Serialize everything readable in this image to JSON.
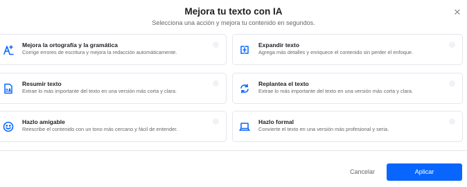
{
  "dialog": {
    "title": "Mejora tu texto con IA",
    "subtitle": "Selecciona una acción y mejora tu contenido en segundos.",
    "close_icon": "close-icon"
  },
  "options": [
    {
      "title": "Mejora la ortografía y la gramática",
      "description": "Corrige errores de escritura y mejora la redacción automáticamente.",
      "icon": "spellcheck-icon"
    },
    {
      "title": "Expandir texto",
      "description": "Agrega más detalles y enriquece el contenido sin perder el enfoque.",
      "icon": "expand-text-icon"
    },
    {
      "title": "Resumir texto",
      "description": "Extrae lo más importante del texto en una versión más corta y clara.",
      "icon": "summarize-icon"
    },
    {
      "title": "Replantea el texto",
      "description": "Extrae lo más importante del texto en una versión más corta y clara.",
      "icon": "rephrase-icon"
    },
    {
      "title": "Hazlo amigable",
      "description": "Reescribe el contenido con un tono más cercano y fácil de entender.",
      "icon": "smile-icon"
    },
    {
      "title": "Hazlo formal",
      "description": "Convierte el texto en una versión más profesional y seria.",
      "icon": "laptop-icon"
    }
  ],
  "footer": {
    "cancel_label": "Cancelar",
    "apply_label": "Aplicar"
  },
  "colors": {
    "accent": "#0866ff",
    "border": "#e4e6eb",
    "muted_text": "#65676b"
  }
}
